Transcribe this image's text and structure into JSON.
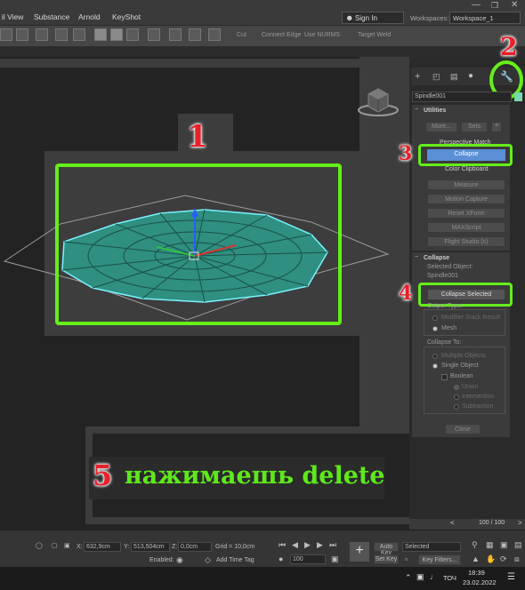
{
  "menu": {
    "items": [
      "il View",
      "Substance",
      "Arnold",
      "KeyShot"
    ],
    "signin": "Sign In",
    "workspaces_label": "Workspaces:",
    "workspace": "Workspace_1"
  },
  "toolbar": {
    "cut": "Cut",
    "connect_edge": "Connect Edge",
    "use_nurms": "Use NURMS",
    "target_weld": "Target Weld"
  },
  "panel": {
    "object_name": "Spindle001",
    "utilities_rollout": "Utilities",
    "more_button": "More...",
    "sets_button": "Sets",
    "utility_items": [
      "Perspective Match",
      "Collapse",
      "Color Clipboard",
      "Measure",
      "Motion Capture",
      "Reset XForm",
      "MAXScript",
      "Flight Studio (c)"
    ],
    "collapse_rollout": "Collapse",
    "selected_object_label": "Selected Object:",
    "selected_object_value": "Spindle001",
    "collapse_selected": "Collapse Selected",
    "output_type_label": "Output Type:",
    "output_options": [
      "Modifier Stack Result",
      "Mesh"
    ],
    "collapse_to_label": "Collapse To:",
    "collapse_to_options": [
      "Multiple Objects",
      "Single Object"
    ],
    "boolean_label": "Boolean",
    "boolean_options": [
      "Union",
      "Intersection",
      "Subtraction"
    ],
    "close_button": "Close"
  },
  "annotations": {
    "n1": "1",
    "n2": "2",
    "n3": "3",
    "n4": "4",
    "n5": "5",
    "caption": "нажимаешь delete"
  },
  "statusbar": {
    "x_label": "X:",
    "x_value": "632,9cm",
    "y_label": "Y:",
    "y_value": "513,504cm",
    "z_label": "Z:",
    "z_value": "0,0cm",
    "grid": "Grid = 10,0cm",
    "enabled": "Enabled:",
    "add_time_tag": "Add Time Tag",
    "auto_key": "Auto Key",
    "set_key": "Set Key",
    "selected": "Selected",
    "key_filters": "Key Filters...",
    "frame": "100 / 100",
    "frame_field": "100"
  },
  "taskbar": {
    "lang": "ТОЧ",
    "time": "18:39",
    "date": "23.02.2022"
  },
  "colors": {
    "annotation_green": "#66ee1a",
    "annotation_red": "#e8202a",
    "highlight_blue": "#5b8fd6"
  }
}
